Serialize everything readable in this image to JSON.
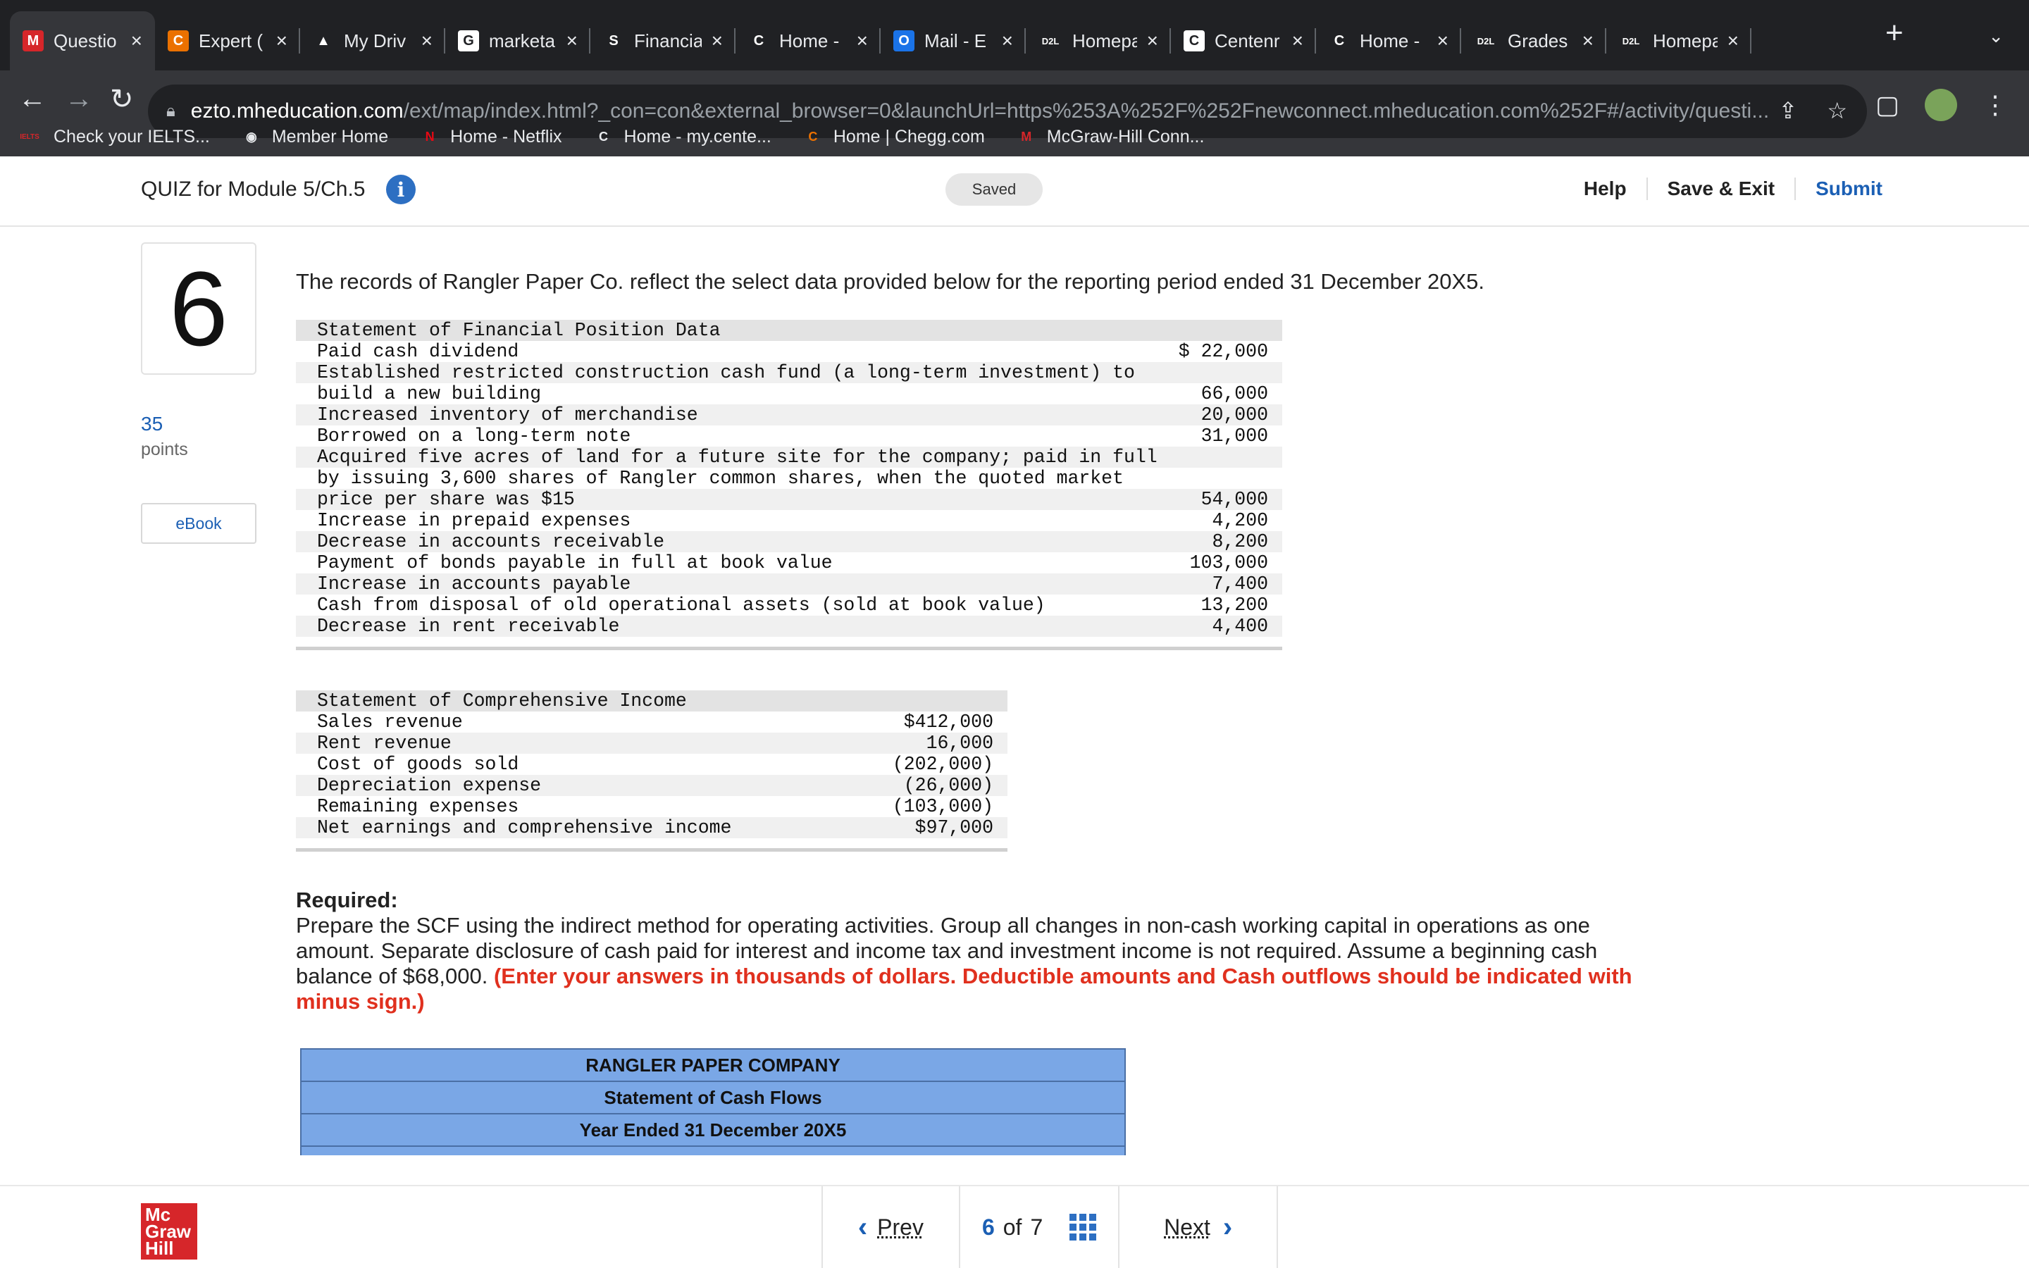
{
  "browser": {
    "tabs": [
      {
        "title": "Questio",
        "icon": "M",
        "icon_bg": "#d6262a",
        "active": true
      },
      {
        "title": "Expert (",
        "icon": "C",
        "icon_bg": "#eb7100",
        "active": false
      },
      {
        "title": "My Driv",
        "icon": "▲",
        "icon_bg": "#202124",
        "active": false
      },
      {
        "title": "marketa",
        "icon": "G",
        "icon_bg": "#ffffff",
        "active": false
      },
      {
        "title": "Financia",
        "icon": "S",
        "icon_bg": "#202124",
        "active": false
      },
      {
        "title": "Home -",
        "icon": "C",
        "icon_bg": "#202124",
        "active": false
      },
      {
        "title": "Mail - E",
        "icon": "O",
        "icon_bg": "#1a73e8",
        "active": false
      },
      {
        "title": "Homepa",
        "icon": "D2L",
        "icon_bg": "#202124",
        "active": false
      },
      {
        "title": "Centenr",
        "icon": "C",
        "icon_bg": "#ffffff",
        "active": false
      },
      {
        "title": "Home -",
        "icon": "C",
        "icon_bg": "#202124",
        "active": false
      },
      {
        "title": "Grades",
        "icon": "D2L",
        "icon_bg": "#202124",
        "active": false
      },
      {
        "title": "Homepa",
        "icon": "D2L",
        "icon_bg": "#202124",
        "active": false
      }
    ],
    "url_host": "ezto.mheducation.com",
    "url_path": "/ext/map/index.html?_con=con&external_browser=0&launchUrl=https%253A%252F%252Fnewconnect.mheducation.com%252F#/activity/questi...",
    "bookmarks": [
      {
        "label": "Check your IELTS...",
        "icon": "IELTS",
        "icon_color": "#d6262a"
      },
      {
        "label": "Member Home",
        "icon": "◉",
        "icon_color": "#e8eaed"
      },
      {
        "label": "Home - Netflix",
        "icon": "N",
        "icon_color": "#e50914"
      },
      {
        "label": "Home - my.cente...",
        "icon": "C",
        "icon_color": "#e8eaed"
      },
      {
        "label": "Home | Chegg.com",
        "icon": "C",
        "icon_color": "#eb7100"
      },
      {
        "label": "McGraw-Hill Conn...",
        "icon": "M",
        "icon_color": "#d6262a"
      }
    ]
  },
  "header": {
    "title": "QUIZ for Module 5/Ch.5",
    "saved": "Saved",
    "help": "Help",
    "save_exit": "Save & Exit",
    "submit": "Submit"
  },
  "question": {
    "number": "6",
    "points": "35",
    "points_label": "points",
    "ebook": "eBook",
    "intro": "The records of Rangler Paper Co. reflect the select data provided below for the reporting period ended 31 December 20X5."
  },
  "sfp": {
    "heading": "Statement of Financial Position Data",
    "rows": [
      {
        "label": "Paid cash dividend",
        "amount": "$ 22,000"
      },
      {
        "label": "Established restricted construction cash fund (a long-term investment) to",
        "amount": ""
      },
      {
        "label": "build a new building",
        "amount": "66,000"
      },
      {
        "label": "Increased inventory of merchandise",
        "amount": "20,000"
      },
      {
        "label": "Borrowed on a long-term note",
        "amount": "31,000"
      },
      {
        "label": "Acquired five acres of land for a future site for the company; paid in full",
        "amount": ""
      },
      {
        "label": "by issuing 3,600 shares of Rangler common shares, when the quoted market",
        "amount": ""
      },
      {
        "label": "price per share was $15",
        "amount": "54,000"
      },
      {
        "label": "Increase in prepaid expenses",
        "amount": "4,200"
      },
      {
        "label": "Decrease in accounts receivable",
        "amount": "8,200"
      },
      {
        "label": "Payment of bonds payable in full at book value",
        "amount": "103,000"
      },
      {
        "label": "Increase in accounts payable",
        "amount": "7,400"
      },
      {
        "label": "Cash from disposal of old operational assets (sold at book value)",
        "amount": "13,200"
      },
      {
        "label": "Decrease in rent receivable",
        "amount": "4,400"
      }
    ]
  },
  "sci": {
    "heading": "Statement of Comprehensive Income",
    "rows": [
      {
        "label": "Sales revenue",
        "amount": "$412,000"
      },
      {
        "label": "Rent revenue",
        "amount": "16,000"
      },
      {
        "label": "Cost of goods sold",
        "amount": "(202,000)"
      },
      {
        "label": "Depreciation expense",
        "amount": "(26,000)"
      },
      {
        "label": "Remaining expenses",
        "amount": "(103,000)"
      },
      {
        "label": "Net earnings and comprehensive income",
        "amount": "$97,000"
      }
    ]
  },
  "required": {
    "heading": "Required:",
    "text": "Prepare the SCF using the indirect method for operating activities. Group all changes in non-cash working capital in operations as one amount. Separate disclosure of cash paid for interest and income tax and investment income is not required. Assume a beginning cash balance of $68,000.",
    "note": "(Enter your answers in thousands of dollars. Deductible amounts and Cash outflows should be indicated with minus sign.)"
  },
  "scf_table": {
    "company": "RANGLER PAPER COMPANY",
    "statement": "Statement of Cash Flows",
    "period": "Year Ended 31 December 20X5"
  },
  "footer": {
    "prev": "Prev",
    "current": "6",
    "of": "of",
    "total": "7",
    "next": "Next",
    "logo": "Mc Graw Hill"
  },
  "colors": {
    "accent_blue": "#1b5fb4",
    "instruction_red": "#e0301e",
    "scf_header_blue": "#7aa7e6",
    "logo_red": "#d6262a"
  }
}
